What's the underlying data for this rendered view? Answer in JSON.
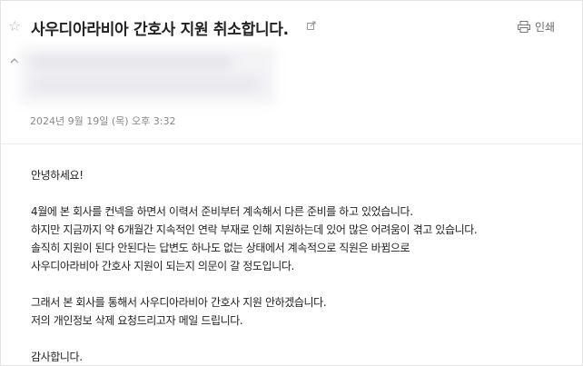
{
  "mail": {
    "subject": "사우디아라비아 간호사 지원 취소합니다.",
    "print_label": "인쇄",
    "date": "2024년 9월 19일 (목) 오후 3:32"
  },
  "body": {
    "greeting": "안녕하세요!",
    "paragraph1": [
      "4월에 본 회사를 컨넥을 하면서 이력서 준비부터 계속해서 다른 준비를 하고 있었습니다.",
      "하지만 지금까지 약 6개월간 지속적인 연락 부재로 인해 지원하는데 있어 많은 어려움이 겪고 있습니다.",
      "솔직히 지원이 된다 안된다는 답변도 하나도 없는 상태에서 계속적으로 직원은 바뀜으로",
      "사우디아라비아 간호사 지원이 되는지 의문이 갈 정도입니다."
    ],
    "paragraph2": [
      "그래서 본 회사를 통해서 사우디아라비아 간호사 지원 안하겠습니다.",
      "저의 개인정보 삭제 요청드리고자 메일 드립니다."
    ],
    "closing": "감사합니다."
  },
  "icons": {
    "star": "star-outline-icon",
    "open_link": "external-link-icon",
    "print": "printer-icon",
    "collapse": "chevron-up-icon"
  },
  "colors": {
    "text": "#222222",
    "muted": "#888888",
    "border": "#e3e3e3"
  }
}
